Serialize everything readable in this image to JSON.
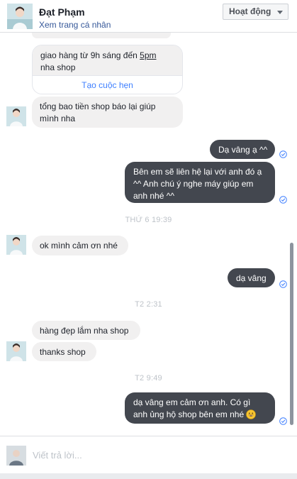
{
  "header": {
    "name": "Đạt Phạm",
    "profile_link": "Xem trang cá nhân",
    "status_button": "Hoạt động"
  },
  "messages": {
    "card_text_1": "giao hàng từ 9h sáng đến ",
    "card_text_time": "5pm",
    "card_text_2": "nha shop",
    "card_action": "Tạo cuộc hẹn",
    "m1": "tổng bao tiền shop báo lại giúp mình nha",
    "m2": "Dạ vâng ạ ^^",
    "m3": "Bên em sẽ liên hệ lại với anh đó ạ ^^ Anh chú ý nghe máy giúp em anh nhé ^^",
    "ts1": "THỨ 6 19:39",
    "m4": "ok mình cảm ơn nhé",
    "m5": "dạ vâng",
    "ts2": "T2 2:31",
    "m6": "hàng đẹp lắm nha shop",
    "m7": "thanks shop",
    "ts3": "T2 9:49",
    "m8": "dạ vâng em cảm ơn anh. Có gì anh ủng hộ shop bên em nhé"
  },
  "composer": {
    "placeholder": "Viết trả lời..."
  },
  "icons": {
    "seen": "check-circle-icon",
    "emoji": "grinning-emoji-icon",
    "caret": "chevron-down-icon"
  },
  "colors": {
    "outgoing_bubble": "#43474f",
    "incoming_bubble": "#f1f0f0",
    "link": "#365899",
    "seen_check": "#4080ff"
  }
}
